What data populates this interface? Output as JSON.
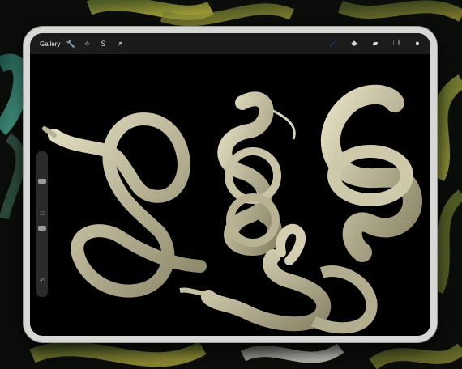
{
  "topbar": {
    "gallery_label": "Gallery",
    "left_tools": [
      {
        "name": "wrench-icon",
        "glyph": "🔧"
      },
      {
        "name": "magic-wand-icon",
        "glyph": "✧"
      },
      {
        "name": "selection-icon",
        "glyph": "S"
      },
      {
        "name": "transform-icon",
        "glyph": "➚"
      }
    ],
    "right_tools": [
      {
        "name": "brush-icon",
        "glyph": "／",
        "color": "#2f7bff"
      },
      {
        "name": "smudge-icon",
        "glyph": "◆",
        "color": "#d8d8d8"
      },
      {
        "name": "eraser-icon",
        "glyph": "▰",
        "color": "#d8d8d8"
      },
      {
        "name": "layers-icon",
        "glyph": "❐",
        "color": "#d8d8d8"
      },
      {
        "name": "color-icon",
        "glyph": "●",
        "color": "#d8d8d8"
      }
    ]
  },
  "sidebar": {
    "undo_glyph": "↶",
    "square_glyph": "□"
  },
  "colors": {
    "snake_main": "#d8d2b4",
    "snake_shadow": "#6f6a56",
    "bg_green": "#3f6f4f",
    "bg_yellow": "#a5a03d"
  }
}
